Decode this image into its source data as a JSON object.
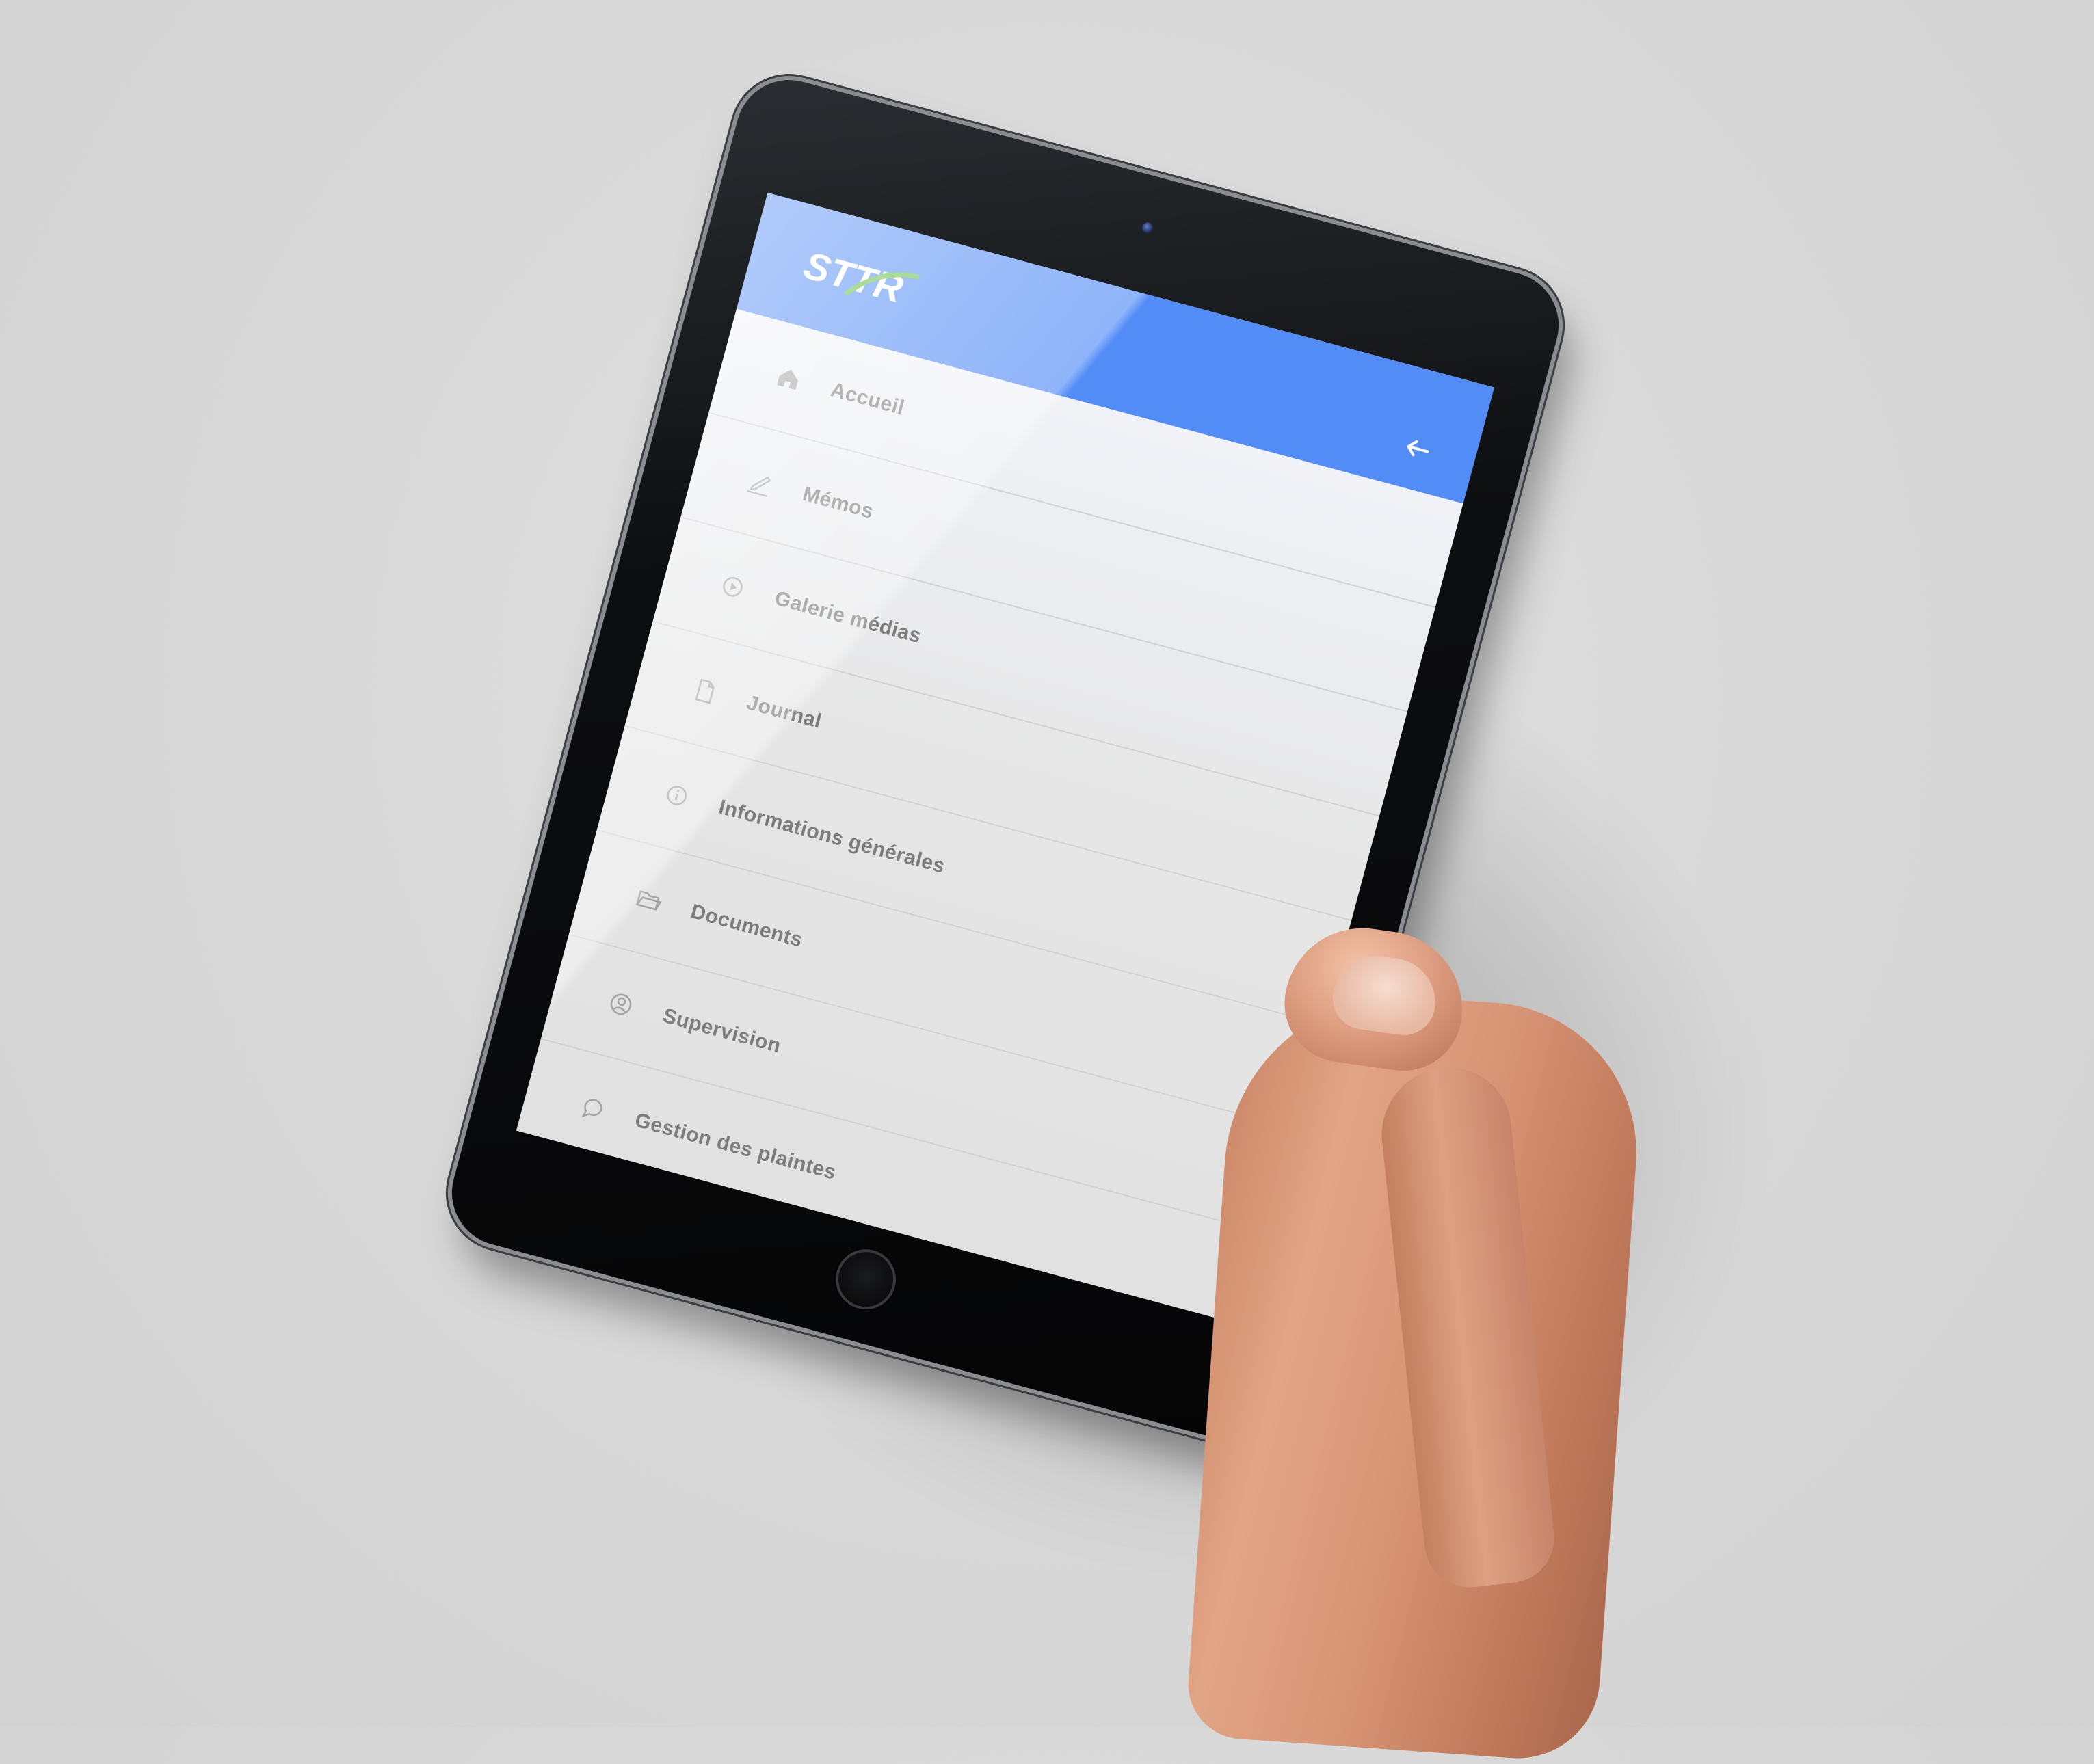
{
  "app": {
    "logo_text": "STTR",
    "back_label": "←"
  },
  "menu": {
    "items": [
      {
        "label": "Accueil",
        "icon": "home-icon"
      },
      {
        "label": "Mémos",
        "icon": "pencil-icon"
      },
      {
        "label": "Galerie médias",
        "icon": "play-circle-icon"
      },
      {
        "label": "Journal",
        "icon": "document-icon"
      },
      {
        "label": "Informations générales",
        "icon": "info-icon"
      },
      {
        "label": "Documents",
        "icon": "folder-icon"
      },
      {
        "label": "Supervision",
        "icon": "user-circle-icon"
      },
      {
        "label": "Gestion des plaintes",
        "icon": "chat-icon"
      }
    ]
  },
  "colors": {
    "header": "#528cf6",
    "logo_green": "#5fbf3a",
    "menu_text": "#7c7c7c"
  }
}
